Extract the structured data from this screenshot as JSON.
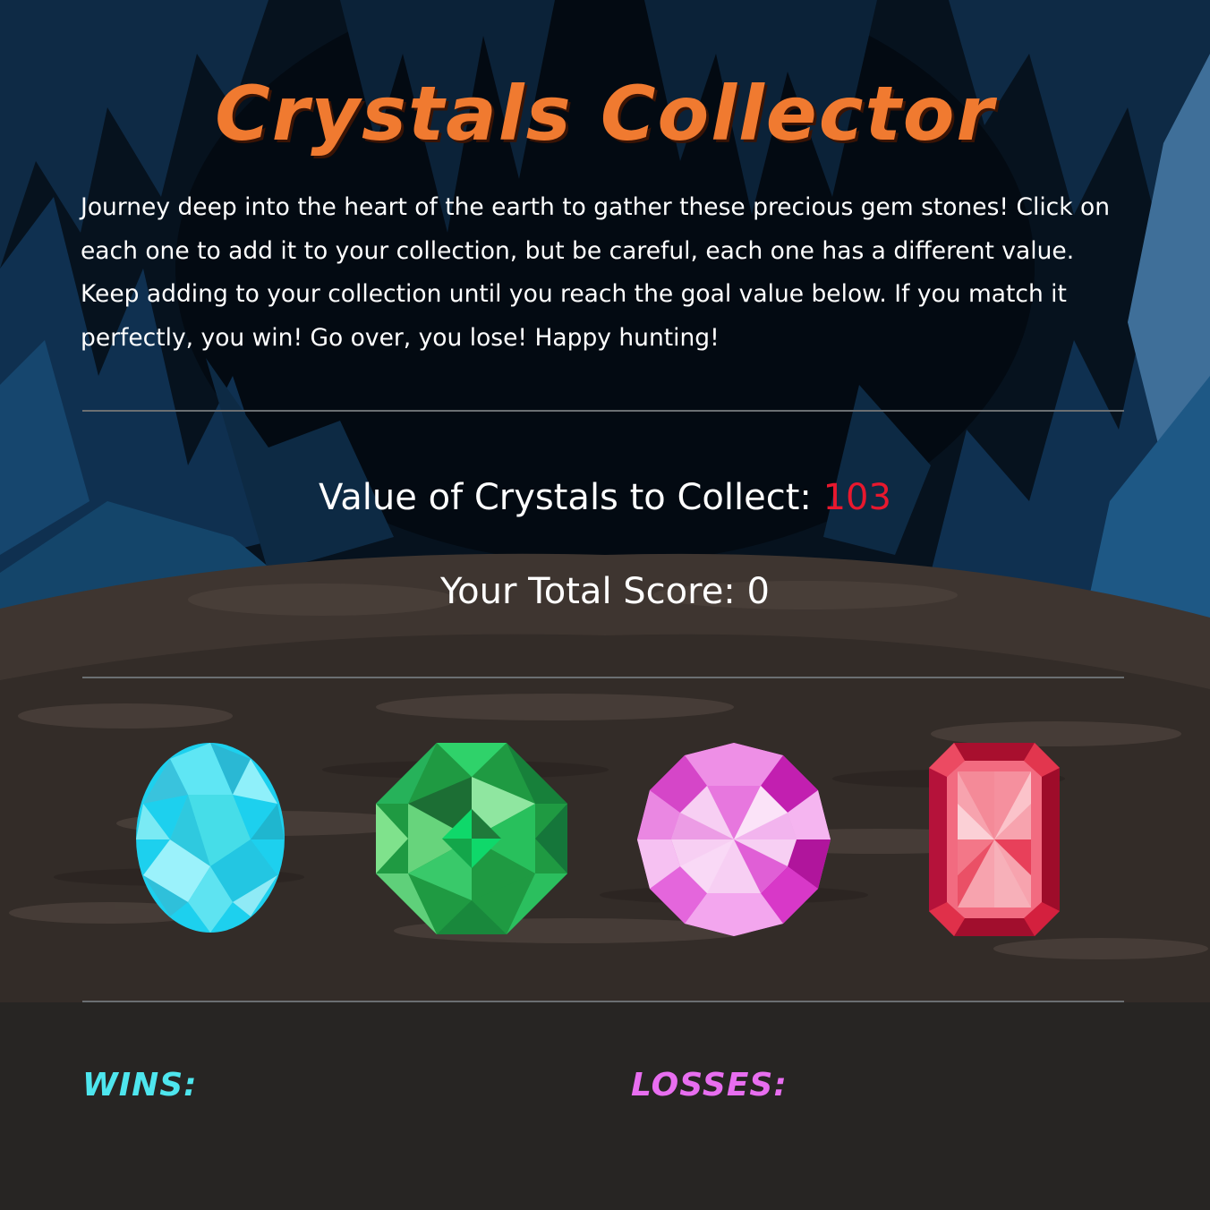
{
  "title": "Crystals Collector",
  "intro": "Journey deep into the heart of the earth to gather these precious gem stones! Click on each one to add it to your collection, but be careful, each one has a different value. Keep adding to your collection until you reach the goal value below. If you match it perfectly, you win! Go over, you lose! Happy hunting!",
  "goal": {
    "label": "Value of Crystals to Collect: ",
    "value": "103"
  },
  "score": {
    "label": "Your Total Score: ",
    "value": "0"
  },
  "gems": [
    {
      "name": "blue-crystal-icon",
      "color": "#25d4f0"
    },
    {
      "name": "green-crystal-icon",
      "color": "#1fa845"
    },
    {
      "name": "pink-crystal-icon",
      "color": "#e25ae0"
    },
    {
      "name": "red-crystal-icon",
      "color": "#d8203e"
    }
  ],
  "stats": {
    "wins_label": "WINS:",
    "losses_label": "LOSSES:"
  },
  "colors": {
    "title": "#f07a30",
    "goal_value": "#e8182e",
    "wins": "#4ee6ee",
    "losses": "#e86ef0"
  }
}
